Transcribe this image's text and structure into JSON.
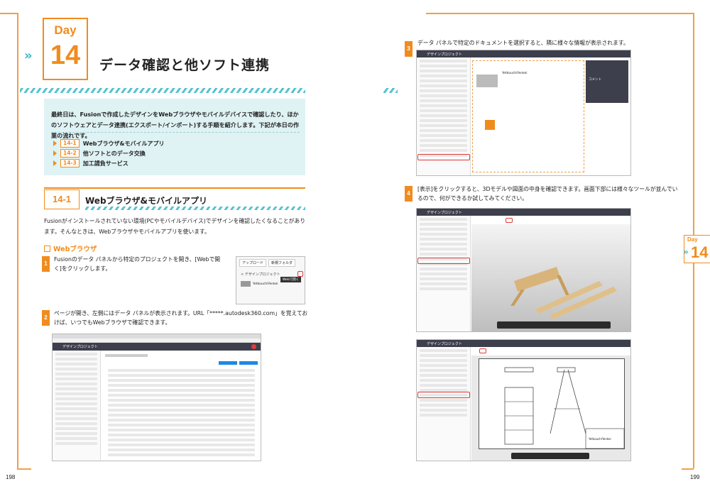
{
  "header": {
    "day_label": "Day",
    "day_number": "14",
    "chevron": "»",
    "title": "データ確認と他ソフト連携"
  },
  "intro": {
    "text": "最終日は、Fusionで作成したデザインをWebブラウザやモバイルデバイスで確認したり、ほかのソフトウェアとデータ連携(エクスポート/インポート)する手順を紹介します。下記が本日の作業の流れです。",
    "toc": [
      {
        "num": "14-1",
        "label": "Webブラウザ&モバイルアプリ"
      },
      {
        "num": "14-2",
        "label": "他ソフトとのデータ交換"
      },
      {
        "num": "14-3",
        "label": "加工請負サービス"
      }
    ]
  },
  "section": {
    "num": "14-1",
    "title": "Webブラウザ&モバイルアプリ",
    "body": "Fusionがインストールされていない環境(PCやモバイルデバイス)でデザインを確認したくなることがあります。そんなときは、Webブラウザやモバイルアプリを使います。",
    "subheading": "Webブラウザ"
  },
  "steps": [
    {
      "num": "1",
      "text": "Fusionのデータ パネルから特定のプロジェクトを開き、[Webで開く]をクリックします。"
    },
    {
      "num": "2",
      "text": "ページが開き、左側にはデータ パネルが表示されます。URL「*****.autodesk360.com」を覚えておけば、いつでもWebブラウザで確認できます。"
    },
    {
      "num": "3",
      "text": "データ パネルで特定のドキュメントを選択すると、隣に様々な情報が表示されます。"
    },
    {
      "num": "4",
      "text": "[表示]をクリックすると、3Dモデルや図面の中身を確認できます。画面下部には様々なツールが並んでいるので、何ができるか試してみてください。"
    }
  ],
  "screenshots": {
    "project_title": "デザインプロジェクト",
    "popup_btn1": "アップロード",
    "popup_btn2": "新規フォルダ",
    "popup_breadcrumb": "< デザインプロジェクト",
    "popup_item": "YetkouchiYenkei",
    "popup_tooltip": "Webで開く",
    "detail_name": "YetkouchiYenkei",
    "comment_header": "コメント",
    "drawing_title": "YetkouchiYenkei"
  },
  "page_numbers": {
    "left": "198",
    "right": "199"
  },
  "side_tab": {
    "day": "Day",
    "num": "14",
    "chevron": "»"
  },
  "colors": {
    "accent": "#f08c1e",
    "teal": "#3bb6c8",
    "highlight": "#e23a3a"
  }
}
